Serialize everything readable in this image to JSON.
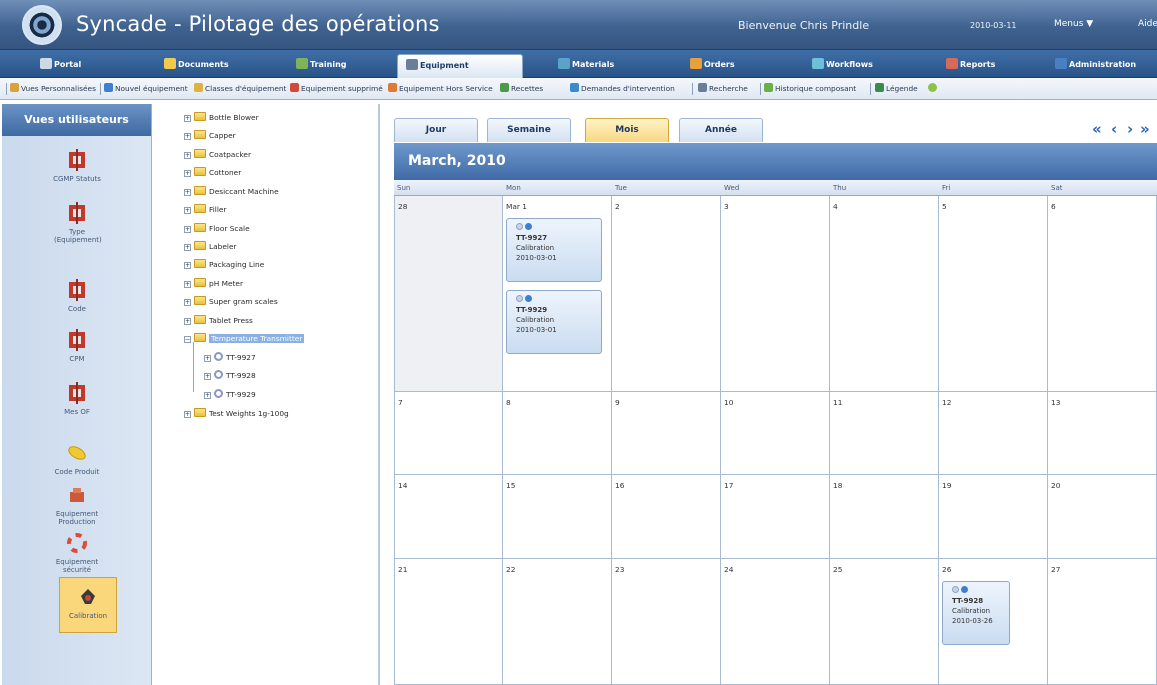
{
  "app": {
    "title": "Syncade - Pilotage des opérations",
    "welcome": "Bienvenue Chris Prindle",
    "date": "2010-03-11",
    "menu_label": "Menus ▼",
    "help_label": "Aide"
  },
  "main_nav": [
    {
      "label": "Portal",
      "icon": "portal-icon",
      "color": "#cfd9e6"
    },
    {
      "label": "Documents",
      "icon": "documents-icon",
      "color": "#f2c94c"
    },
    {
      "label": "Training",
      "icon": "training-icon",
      "color": "#7fb35a"
    },
    {
      "label": "Equipment",
      "icon": "equipment-icon",
      "color": "#6a7d99",
      "active": true
    },
    {
      "label": "Materials",
      "icon": "materials-icon",
      "color": "#5aa2c8"
    },
    {
      "label": "Orders",
      "icon": "orders-icon",
      "color": "#e8a13a"
    },
    {
      "label": "Workflows",
      "icon": "workflows-icon",
      "color": "#6cc0d8"
    },
    {
      "label": "Reports",
      "icon": "reports-icon",
      "color": "#d66a5a"
    },
    {
      "label": "Administration",
      "icon": "administration-icon",
      "color": "#4a7fc4"
    }
  ],
  "toolbar": [
    {
      "label": "Vues Personnalisées",
      "icon": "custom-views-icon",
      "color": "#d9a23a"
    },
    {
      "label": "Nouvel équipement",
      "icon": "new-equipment-icon",
      "color": "#3d7fd0"
    },
    {
      "label": "Classes d'équipement",
      "icon": "equipment-classes-icon",
      "color": "#e0b040"
    },
    {
      "label": "Equipement supprimé",
      "icon": "deleted-equipment-icon",
      "color": "#d04a3a"
    },
    {
      "label": "Equipement Hors Service",
      "icon": "out-of-service-icon",
      "color": "#e07a3a"
    },
    {
      "label": "Recettes",
      "icon": "recipes-icon",
      "color": "#4a9a4a"
    },
    {
      "label": "Demandes d'intervention",
      "icon": "intervention-requests-icon",
      "color": "#3a8ad0"
    },
    {
      "label": "Recherche",
      "icon": "search-icon",
      "color": "#6a7d99"
    },
    {
      "label": "Historique composant",
      "icon": "component-history-icon",
      "color": "#6ab04a"
    },
    {
      "label": "Légende",
      "icon": "legend-icon",
      "color": "#3a8a4a"
    }
  ],
  "left_panel": {
    "header": "Vues utilisateurs",
    "views": [
      {
        "label": "CGMP Statuts",
        "icon": "cgmp-status-icon"
      },
      {
        "label": "Type (Equipement)",
        "icon": "equipment-type-icon"
      },
      {
        "label": "Code",
        "icon": "code-icon"
      },
      {
        "label": "CPM",
        "icon": "cpm-icon"
      },
      {
        "label": "Mes OF",
        "icon": "my-orders-icon"
      },
      {
        "label": "Code Produit",
        "icon": "product-code-icon"
      },
      {
        "label": "Equipement Production",
        "icon": "production-equipment-icon"
      },
      {
        "label": "Equipement sécurité",
        "icon": "safety-equipment-icon"
      },
      {
        "label": "Calibration",
        "icon": "calibration-icon",
        "selected": true
      }
    ]
  },
  "tree": {
    "items": [
      {
        "label": "Bottle Blower"
      },
      {
        "label": "Capper"
      },
      {
        "label": "Coatpacker"
      },
      {
        "label": "Cottoner"
      },
      {
        "label": "Desiccant Machine"
      },
      {
        "label": "Filler"
      },
      {
        "label": "Floor Scale"
      },
      {
        "label": "Labeler"
      },
      {
        "label": "Packaging Line"
      },
      {
        "label": "pH Meter"
      },
      {
        "label": "Super gram scales"
      },
      {
        "label": "Tablet Press"
      },
      {
        "label": "Temperature Transmitter",
        "expanded": true,
        "selected": true
      },
      {
        "label": "TT-9927",
        "child": true
      },
      {
        "label": "TT-9928",
        "child": true
      },
      {
        "label": "TT-9929",
        "child": true
      },
      {
        "label": "Test Weights 1g-100g"
      }
    ]
  },
  "calendar": {
    "tabs": [
      "Jour",
      "Semaine",
      "Mois",
      "Année"
    ],
    "active_tab": "Mois",
    "nav_first": "«",
    "nav_prev": "‹",
    "nav_next": "›",
    "nav_last": "»",
    "month_title": "March, 2010",
    "day_names": [
      "Sun",
      "Mon",
      "Tue",
      "Wed",
      "Thu",
      "Fri",
      "Sat"
    ],
    "weeks": [
      [
        "28",
        "Mar 1",
        "2",
        "3",
        "4",
        "5",
        "6"
      ],
      [
        "7",
        "8",
        "9",
        "10",
        "11",
        "12",
        "13"
      ],
      [
        "14",
        "15",
        "16",
        "17",
        "18",
        "19",
        "20"
      ],
      [
        "21",
        "22",
        "23",
        "24",
        "25",
        "26",
        "27"
      ]
    ],
    "events": [
      {
        "id": "TT-9927",
        "type": "Calibration",
        "date": "2010-03-01"
      },
      {
        "id": "TT-9929",
        "type": "Calibration",
        "date": "2010-03-01"
      },
      {
        "id": "TT-9928",
        "type": "Calibration",
        "date": "2010-03-26"
      }
    ]
  }
}
